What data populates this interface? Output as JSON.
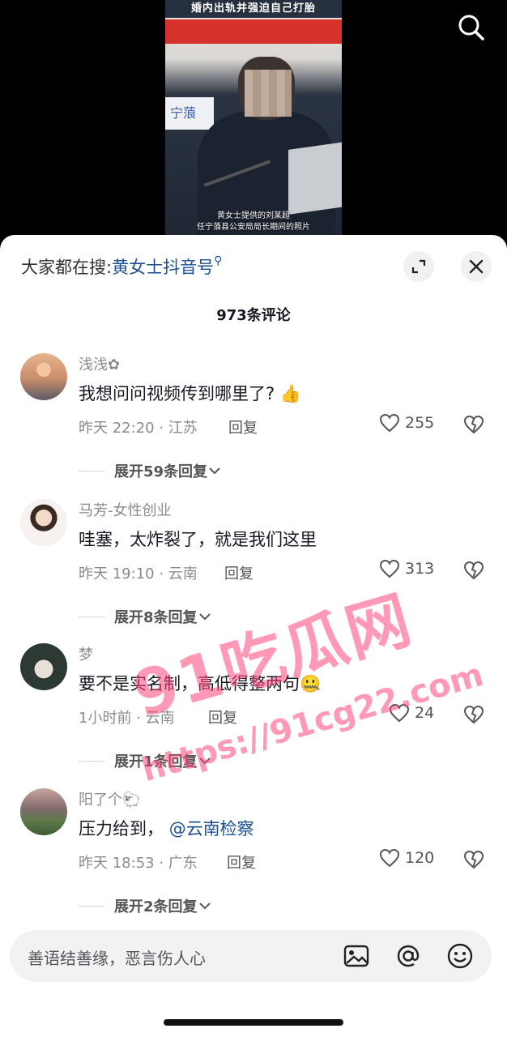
{
  "video": {
    "caption_top": "婚内出轨并强迫自己打胎",
    "emblem_text": "宁蒗",
    "caption_bottom_line1": "黄女士提供的刘某超",
    "caption_bottom_line2": "任宁蒗县公安局局长期间的照片"
  },
  "header": {
    "search_prefix": "大家都在搜:",
    "search_keyword": "黄女士抖音号",
    "comment_count": "973条评论"
  },
  "comments": [
    {
      "username": "浅浅✿",
      "text": "我想问问视频传到哪里了?",
      "emoji": "👍",
      "time_location": "昨天 22:20 · 江苏",
      "reply_label": "回复",
      "likes": "255",
      "expand_label": "展开59条回复"
    },
    {
      "username": "马芳-女性创业",
      "text": "哇塞，太炸裂了，就是我们这里",
      "time_location": "昨天 19:10 · 云南",
      "reply_label": "回复",
      "likes": "313",
      "expand_label": "展开8条回复"
    },
    {
      "username": "梦",
      "text": "要不是实名制，高低得整两句",
      "emoji": "🤐",
      "time_location": "1小时前 · 云南",
      "reply_label": "回复",
      "likes": "24",
      "expand_label": "展开1条回复"
    },
    {
      "username": "阳了个🐑",
      "text": "压力给到，",
      "mention": "@云南检察",
      "time_location": "昨天 18:53 · 广东",
      "reply_label": "回复",
      "likes": "120",
      "expand_label": "展开2条回复"
    }
  ],
  "input": {
    "placeholder": "善语结善缘，恶言伤人心"
  },
  "watermark": {
    "title": "91吃瓜网",
    "url": "https://91cg22.com"
  },
  "icons": [
    "search-icon",
    "expand-icon",
    "close-icon",
    "heart-icon",
    "broken-heart-icon",
    "chevron-down-icon",
    "image-icon",
    "at-icon",
    "emoji-icon"
  ]
}
